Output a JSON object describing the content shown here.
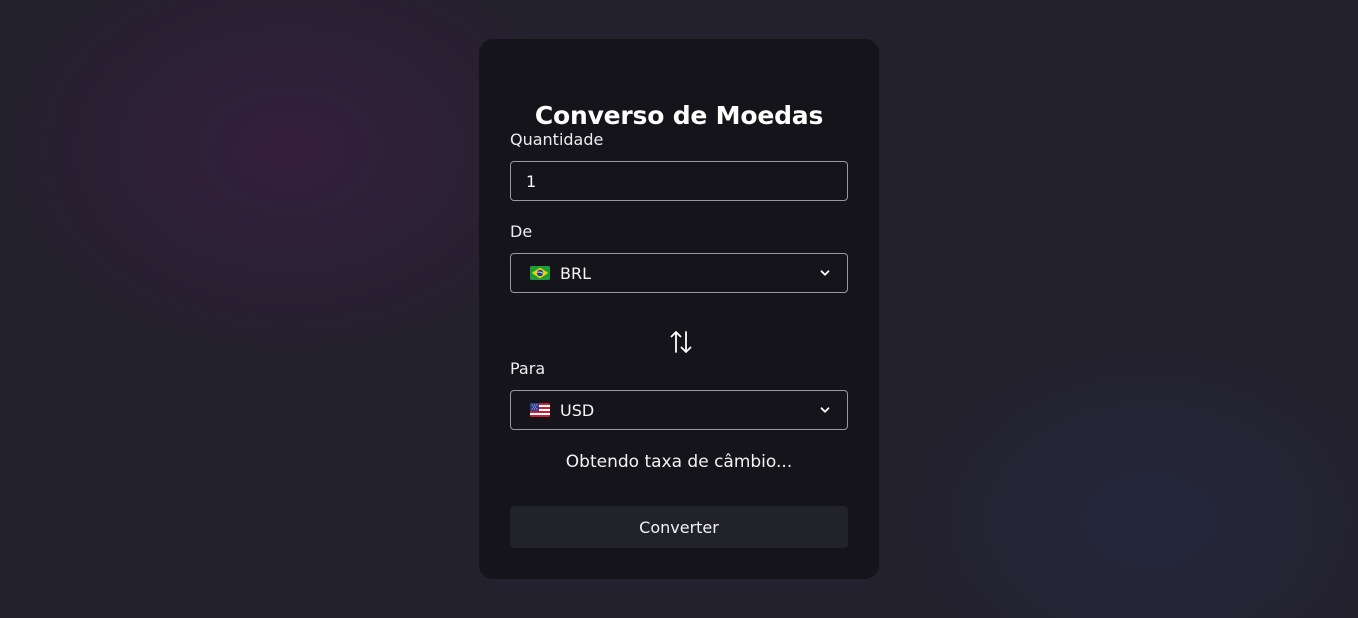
{
  "converter": {
    "title": "Converso de Moedas",
    "amount": {
      "label": "Quantidade",
      "value": "1"
    },
    "from": {
      "label": "De",
      "flag_icon": "brazil-flag-icon",
      "currency": "BRL"
    },
    "swap_icon": "swap-arrows-icon",
    "to": {
      "label": "Para",
      "flag_icon": "us-flag-icon",
      "currency": "USD"
    },
    "status_text": "Obtendo taxa de câmbio...",
    "convert_label": "Converter"
  },
  "colors": {
    "background": "#24212e",
    "card": "#15141a",
    "button": "#22232a",
    "field_border": "#9a99a3",
    "text": "#f2f2f4"
  }
}
